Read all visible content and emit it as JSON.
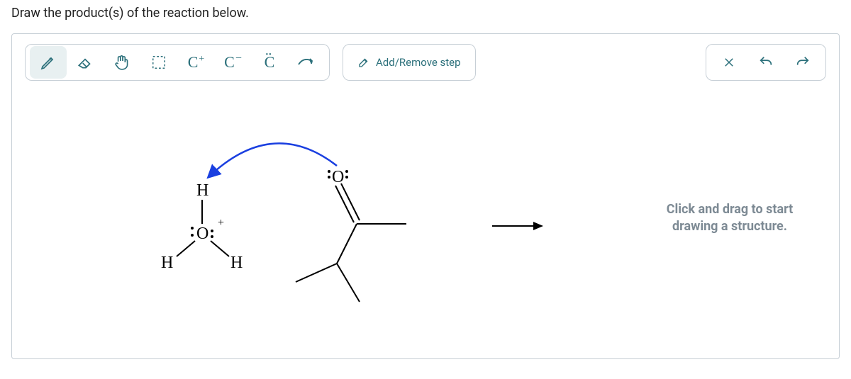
{
  "prompt": "Draw the product(s) of the reaction below.",
  "toolbar": {
    "pencil": "pencil-icon",
    "eraser": "eraser-icon",
    "pan": "pan-icon",
    "select": "select-icon",
    "c_plus": "C",
    "c_minus": "C",
    "c_dots": "C",
    "curve_arrow": "curve-arrow-icon",
    "add_remove_label": "Add/Remove step",
    "close": "close-icon",
    "undo": "undo-icon",
    "redo": "redo-icon"
  },
  "canvas": {
    "hint_line1": "Click and drag to start",
    "hint_line2": "drawing a structure.",
    "atoms": {
      "H_top": "H",
      "H_left": "H",
      "H_right": "H",
      "O_plus": "O",
      "plus": "+",
      "O_carbonyl": "O"
    }
  }
}
